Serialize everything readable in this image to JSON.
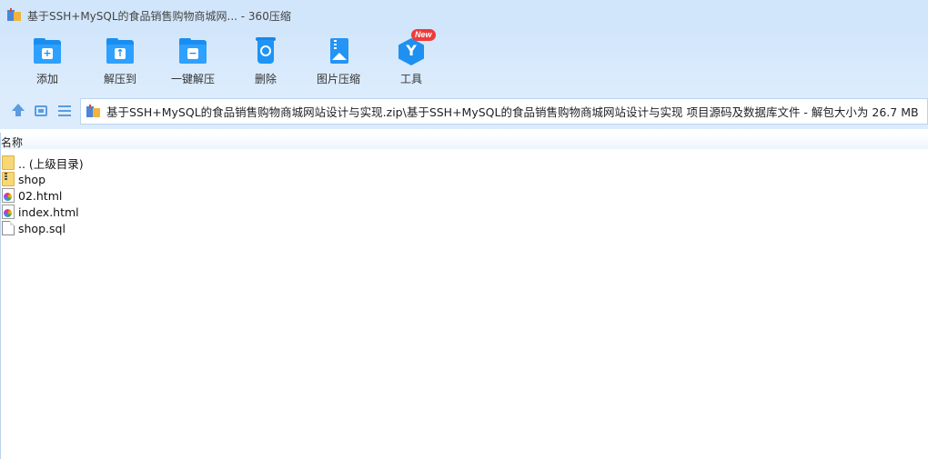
{
  "window": {
    "title": "基于SSH+MySQL的食品销售购物商城网... - 360压缩"
  },
  "toolbar": {
    "items": [
      {
        "label": "添加",
        "icon": "add-folder-icon"
      },
      {
        "label": "解压到",
        "icon": "extract-to-icon"
      },
      {
        "label": "一键解压",
        "icon": "one-click-extract-icon"
      },
      {
        "label": "删除",
        "icon": "trash-icon"
      },
      {
        "label": "图片压缩",
        "icon": "image-compress-icon"
      },
      {
        "label": "工具",
        "icon": "tools-icon"
      }
    ],
    "new_badge": "New"
  },
  "address": {
    "path": "基于SSH+MySQL的食品销售购物商城网站设计与实现.zip\\基于SSH+MySQL的食品销售购物商城网站设计与实现 项目源码及数据库文件 - 解包大小为 26.7 MB"
  },
  "list": {
    "header": "名称",
    "rows": [
      {
        "name": ".. (上级目录)",
        "type": "parent-folder"
      },
      {
        "name": "shop",
        "type": "folder"
      },
      {
        "name": "02.html",
        "type": "html"
      },
      {
        "name": "index.html",
        "type": "html"
      },
      {
        "name": "shop.sql",
        "type": "file"
      }
    ]
  },
  "colors": {
    "accent": "#1a8ef0",
    "titlebar": "#d2e6fb",
    "toolbar": "#dcecfc"
  }
}
